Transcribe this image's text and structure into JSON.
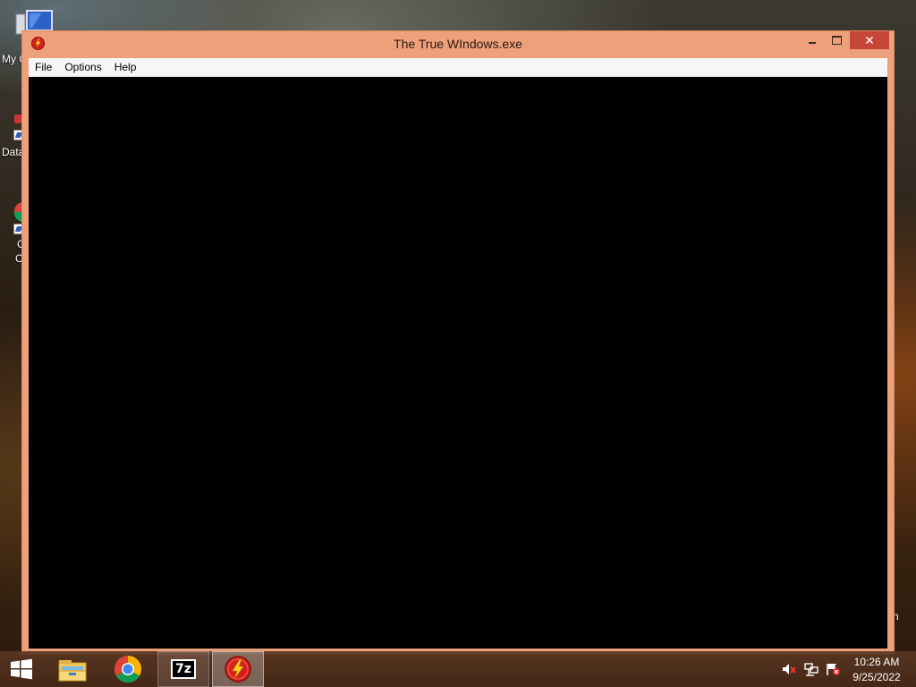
{
  "desktop": {
    "icons": [
      {
        "label": "My C",
        "icon": "computer-icon"
      },
      {
        "label": "Data",
        "icon": "shortcut-icon"
      },
      {
        "label": "G",
        "icon": "chrome-shortcut-icon"
      },
      {
        "label": "C",
        "icon": "chrome-shortcut-icon"
      }
    ],
    "edge_fragment": "n"
  },
  "window": {
    "title": "The True WIndows.exe",
    "icon": "app-lightning-icon",
    "title_bar_color": "#eea07a",
    "close_color": "#c7463a",
    "menu": [
      {
        "label": "File"
      },
      {
        "label": "Options"
      },
      {
        "label": "Help"
      }
    ],
    "client_background": "#000000"
  },
  "taskbar": {
    "start_icon": "windows-logo-icon",
    "pinned": [
      {
        "name": "File Explorer",
        "icon": "folder-icon"
      },
      {
        "name": "Google Chrome",
        "icon": "chrome-icon"
      },
      {
        "name": "7-Zip",
        "icon": "7zip-icon",
        "label": "7z"
      },
      {
        "name": "The True WIndows.exe",
        "icon": "app-lightning-icon",
        "active": true
      }
    ],
    "tray": [
      {
        "icon": "volume-muted-icon"
      },
      {
        "icon": "network-icon"
      },
      {
        "icon": "action-center-flag-icon"
      }
    ],
    "clock": {
      "time": "10:26 AM",
      "date": "9/25/2022"
    }
  }
}
